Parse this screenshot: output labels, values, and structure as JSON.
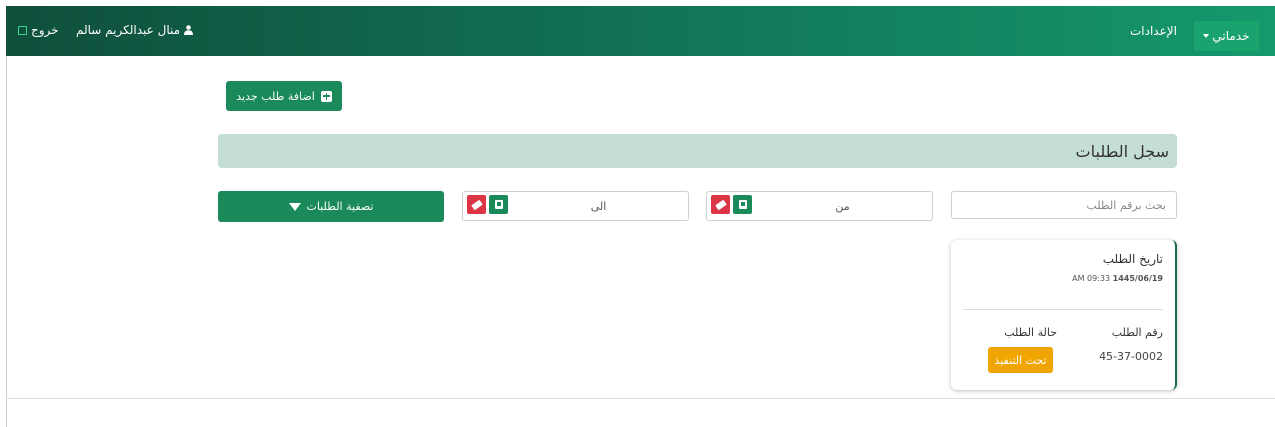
{
  "navbar": {
    "services_label": "خدماتي",
    "settings_label": "الإعدادات",
    "user_name": "منال عبدالكريم سالم",
    "logout_label": "خروج"
  },
  "actions": {
    "add_request_label": "اضافة طلب جديد"
  },
  "page": {
    "title": "سجل الطلبات"
  },
  "filters": {
    "search_placeholder": "بحث برقم الطلب",
    "from_label": "من",
    "to_label": "الى",
    "filter_button_label": "تصفية الطلبات"
  },
  "request_card": {
    "date_label": "تاريخ الطلب",
    "date": "1445/06/19",
    "time": "AM 09:33",
    "number_label": "رقم الطلب",
    "number": "45-37-0002",
    "status_label": "حالة الطلب",
    "status": "تحت التنفيذ"
  },
  "colors": {
    "primary": "#1a8a5a",
    "nav_start": "#0f4f3c",
    "nav_end": "#15986c",
    "title_bar": "#c4ded3",
    "danger": "#dc3545",
    "status_pending": "#f0a500"
  },
  "icons": {
    "user": "user-icon",
    "logout": "logout-icon",
    "add": "plus-square-icon",
    "calendar": "calendar-icon",
    "clear": "eraser-icon",
    "filter": "filter-icon"
  }
}
